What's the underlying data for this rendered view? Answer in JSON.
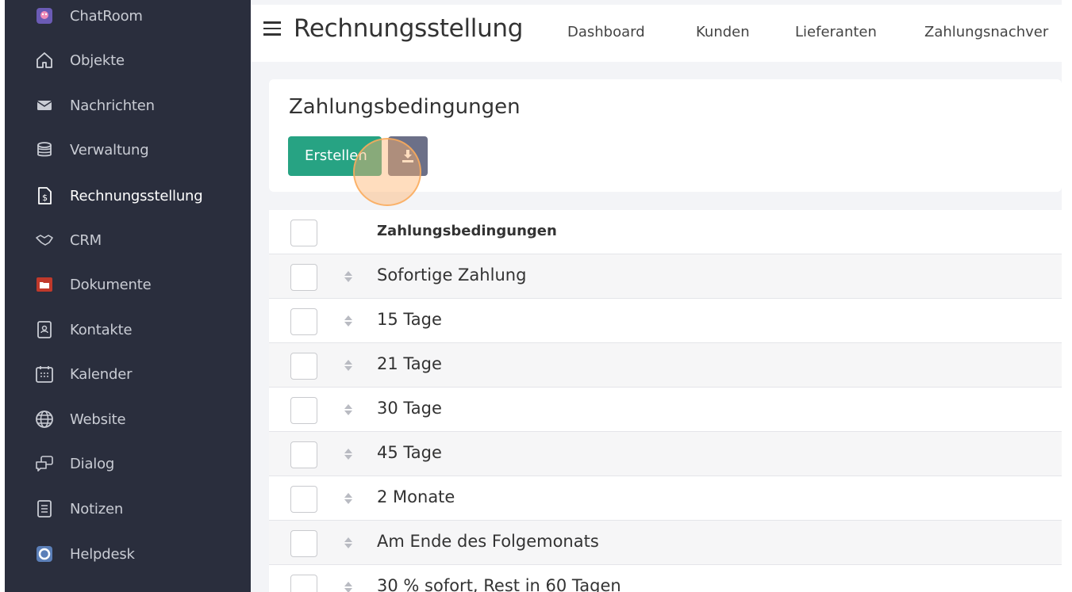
{
  "sidebar": {
    "items": [
      {
        "label": "ChatRoom",
        "icon": "chatroom-icon"
      },
      {
        "label": "Objekte",
        "icon": "house-icon"
      },
      {
        "label": "Nachrichten",
        "icon": "envelope-icon"
      },
      {
        "label": "Verwaltung",
        "icon": "coins-icon"
      },
      {
        "label": "Rechnungsstellung",
        "icon": "invoice-icon",
        "active": true
      },
      {
        "label": "CRM",
        "icon": "handshake-icon"
      },
      {
        "label": "Dokumente",
        "icon": "folder-icon"
      },
      {
        "label": "Kontakte",
        "icon": "contact-book-icon"
      },
      {
        "label": "Kalender",
        "icon": "calendar-icon"
      },
      {
        "label": "Website",
        "icon": "globe-icon"
      },
      {
        "label": "Dialog",
        "icon": "chat-bubbles-icon"
      },
      {
        "label": "Notizen",
        "icon": "notes-icon"
      },
      {
        "label": "Helpdesk",
        "icon": "lifebuoy-icon"
      }
    ]
  },
  "header": {
    "title": "Rechnungsstellung",
    "nav": [
      "Dashboard",
      "Kunden",
      "Lieferanten",
      "Zahlungsnachver"
    ]
  },
  "card": {
    "title": "Zahlungsbedingungen",
    "create_label": "Erstellen",
    "download_icon": "download-icon"
  },
  "table": {
    "header": "Zahlungsbedingungen",
    "rows": [
      "Sofortige Zahlung",
      "15 Tage",
      "21 Tage",
      "30 Tage",
      "45 Tage",
      "2 Monate",
      "Am Ende des Folgemonats",
      "30 % sofort, Rest in 60 Tagen"
    ]
  },
  "colors": {
    "sidebar_bg": "#2a2e3d",
    "primary_button": "#27a383",
    "secondary_button": "#6c7088",
    "click_highlight": "#f5a55a"
  }
}
